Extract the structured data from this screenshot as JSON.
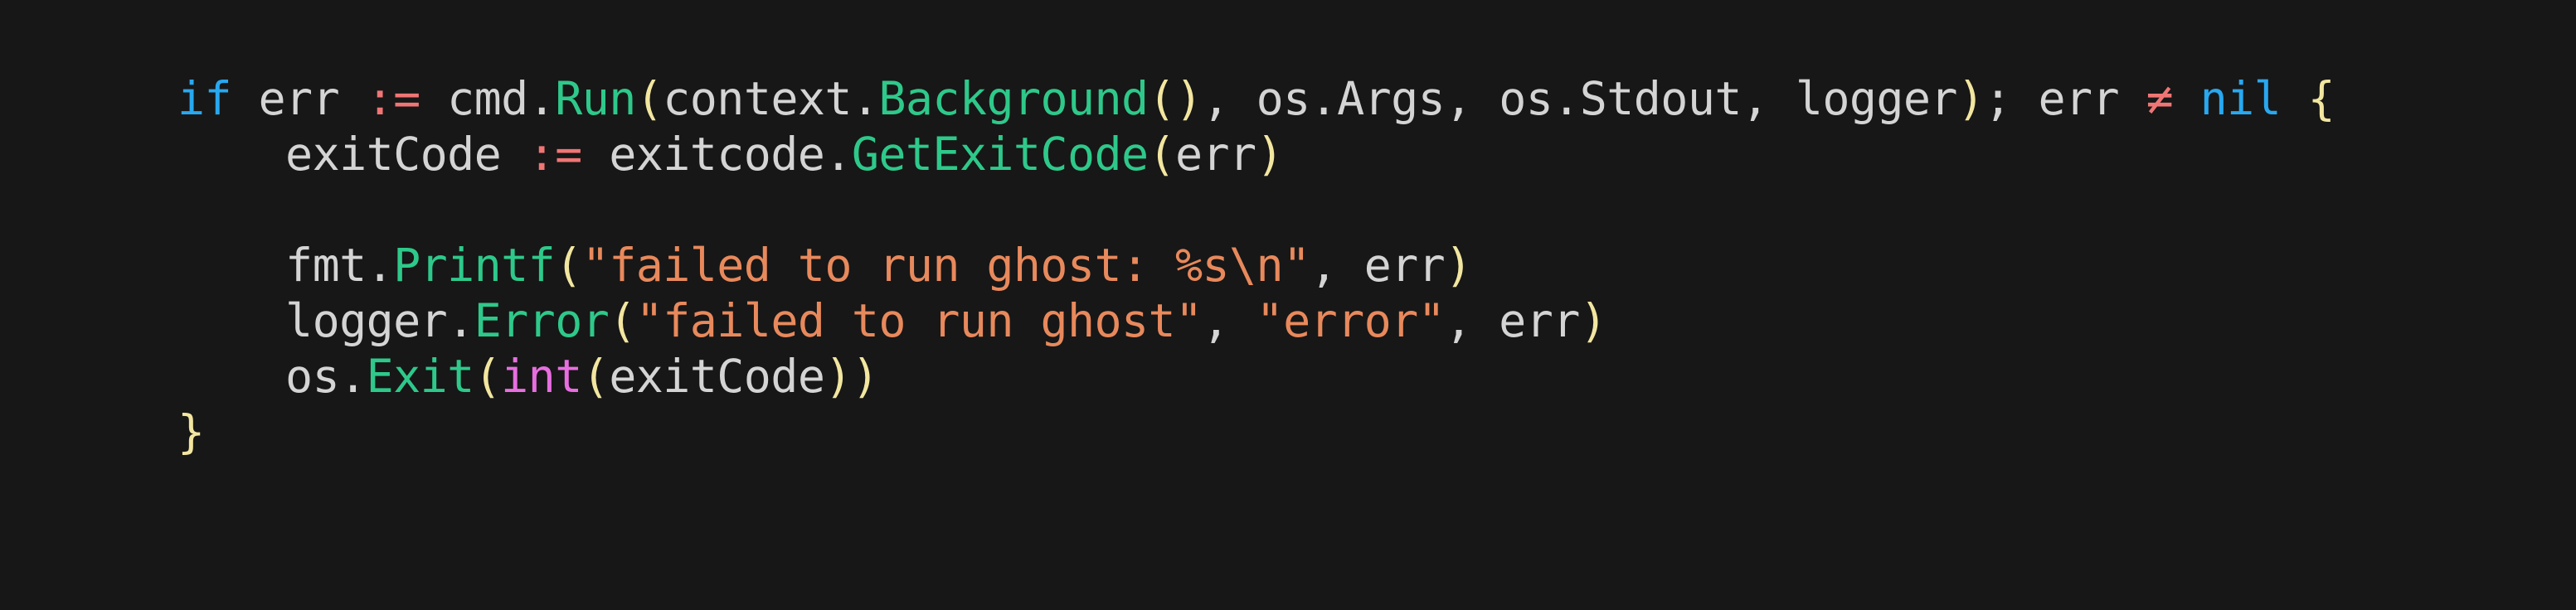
{
  "theme": {
    "background": "#171717",
    "colors": {
      "keyword": "#28a8f0",
      "ident": "#d4d4d4",
      "operator": "#f07575",
      "punct": "#d4d4d4",
      "func": "#2ec98a",
      "paren": "#f2e6a0",
      "string": "#e8895c",
      "type": "#e86ee0"
    }
  },
  "code_lines": [
    {
      "tokens": [
        {
          "t": "if",
          "k": "keyword"
        },
        {
          "t": " err ",
          "k": "ident"
        },
        {
          "t": ":=",
          "k": "operator"
        },
        {
          "t": " cmd",
          "k": "ident"
        },
        {
          "t": ".",
          "k": "punct"
        },
        {
          "t": "Run",
          "k": "func"
        },
        {
          "t": "(",
          "k": "paren"
        },
        {
          "t": "context",
          "k": "ident"
        },
        {
          "t": ".",
          "k": "punct"
        },
        {
          "t": "Background",
          "k": "func"
        },
        {
          "t": "()",
          "k": "paren"
        },
        {
          "t": ", os",
          "k": "ident"
        },
        {
          "t": ".",
          "k": "punct"
        },
        {
          "t": "Args, os",
          "k": "ident"
        },
        {
          "t": ".",
          "k": "punct"
        },
        {
          "t": "Stdout, logger",
          "k": "ident"
        },
        {
          "t": ")",
          "k": "paren"
        },
        {
          "t": "; err ",
          "k": "ident"
        },
        {
          "t": "≠",
          "k": "operator"
        },
        {
          "t": " ",
          "k": "ident"
        },
        {
          "t": "nil",
          "k": "keyword"
        },
        {
          "t": " ",
          "k": "ident"
        },
        {
          "t": "{",
          "k": "paren"
        }
      ]
    },
    {
      "tokens": [
        {
          "t": "    exitCode ",
          "k": "ident"
        },
        {
          "t": ":=",
          "k": "operator"
        },
        {
          "t": " exitcode",
          "k": "ident"
        },
        {
          "t": ".",
          "k": "punct"
        },
        {
          "t": "GetExitCode",
          "k": "func"
        },
        {
          "t": "(",
          "k": "paren"
        },
        {
          "t": "err",
          "k": "ident"
        },
        {
          "t": ")",
          "k": "paren"
        }
      ]
    },
    {
      "tokens": []
    },
    {
      "tokens": [
        {
          "t": "    fmt",
          "k": "ident"
        },
        {
          "t": ".",
          "k": "punct"
        },
        {
          "t": "Printf",
          "k": "func"
        },
        {
          "t": "(",
          "k": "paren"
        },
        {
          "t": "\"failed to run ghost: %s\\n\"",
          "k": "string"
        },
        {
          "t": ", err",
          "k": "ident"
        },
        {
          "t": ")",
          "k": "paren"
        }
      ]
    },
    {
      "tokens": [
        {
          "t": "    logger",
          "k": "ident"
        },
        {
          "t": ".",
          "k": "punct"
        },
        {
          "t": "Error",
          "k": "func"
        },
        {
          "t": "(",
          "k": "paren"
        },
        {
          "t": "\"failed to run ghost\"",
          "k": "string"
        },
        {
          "t": ", ",
          "k": "ident"
        },
        {
          "t": "\"error\"",
          "k": "string"
        },
        {
          "t": ", err",
          "k": "ident"
        },
        {
          "t": ")",
          "k": "paren"
        }
      ]
    },
    {
      "tokens": [
        {
          "t": "    os",
          "k": "ident"
        },
        {
          "t": ".",
          "k": "punct"
        },
        {
          "t": "Exit",
          "k": "func"
        },
        {
          "t": "(",
          "k": "paren"
        },
        {
          "t": "int",
          "k": "type"
        },
        {
          "t": "(",
          "k": "paren"
        },
        {
          "t": "exitCode",
          "k": "ident"
        },
        {
          "t": "))",
          "k": "paren"
        }
      ]
    },
    {
      "tokens": [
        {
          "t": "}",
          "k": "paren"
        }
      ]
    }
  ]
}
